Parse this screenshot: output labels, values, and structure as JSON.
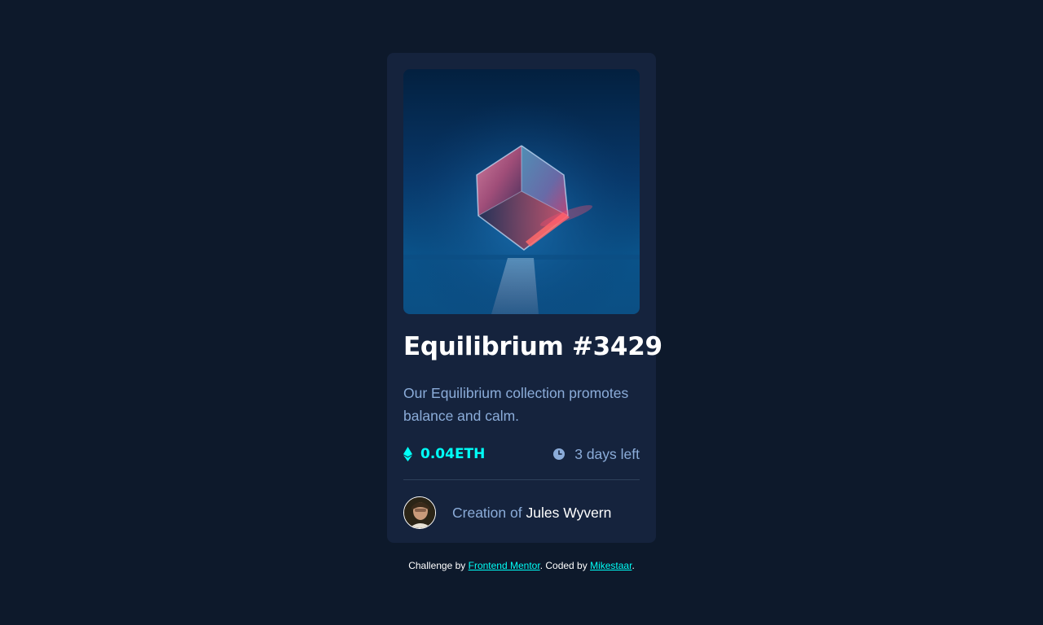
{
  "card": {
    "title": "Equilibrium #3429",
    "description": "Our Equilibrium collection promotes balance and calm.",
    "price": "0.04ETH",
    "time_left": "3 days left",
    "creator_prefix": "Creation of",
    "creator_name": "Jules Wyvern",
    "image_icon": "cube-image",
    "price_icon": "ethereum-icon",
    "time_icon": "clock-icon"
  },
  "attribution": {
    "prefix": "Challenge by",
    "link1": "Frontend Mentor",
    "middle": ". Coded by",
    "link2": "Mikestaar",
    "suffix": "."
  },
  "colors": {
    "background": "#0d192b",
    "card": "#15233d",
    "accent": "#00fff7",
    "muted_text": "#8bacd9",
    "title": "#ffffff",
    "divider": "#2e405a"
  }
}
